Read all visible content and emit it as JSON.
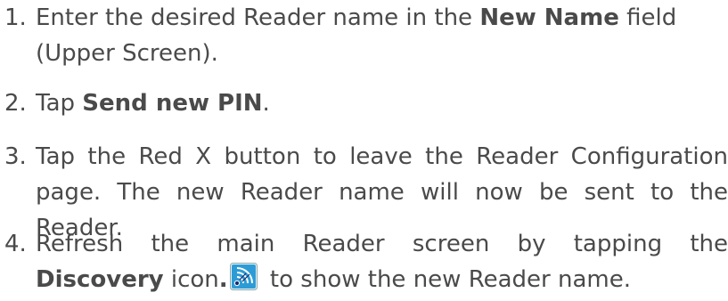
{
  "steps": [
    {
      "number": "1.",
      "line1_pre": "Enter the desired Reader name in the ",
      "line1_bold": "New Name",
      "line1_post": " field",
      "line2": "(Upper Screen)."
    },
    {
      "number": "2.",
      "pre": "Tap ",
      "bold": "Send new PIN",
      "post": "."
    },
    {
      "number": "3.",
      "line1": "Tap the Red X button to leave the Reader Configuration",
      "line2": "page.  The new Reader name will now be sent to the",
      "line3": "Reader."
    },
    {
      "number": "4.",
      "line1": "Refresh the main Reader screen by tapping the",
      "line2_bold": "Discovery",
      "line2_mid": " icon",
      "line2_bold2": ".",
      "line2_post": " to show the new Reader name.",
      "icon": "discovery-icon"
    }
  ],
  "colors": {
    "text": "#4a4a4a",
    "icon_bg": "#2d9cd6",
    "icon_accent": "#ffffff"
  }
}
